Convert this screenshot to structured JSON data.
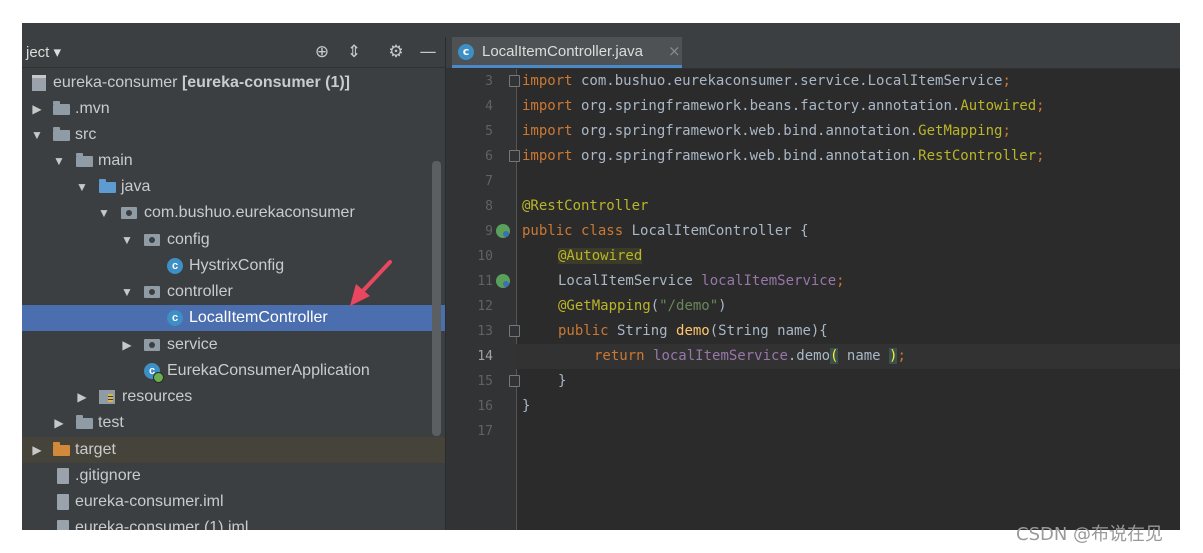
{
  "project_panel": {
    "title": "ject ▾",
    "tree": [
      {
        "label": "eureka-consumer",
        "bold": "[eureka-consumer (1)]"
      },
      {
        "label": ".mvn"
      },
      {
        "label": "src"
      },
      {
        "label": "main"
      },
      {
        "label": "java"
      },
      {
        "label": "com.bushuo.eurekaconsumer"
      },
      {
        "label": "config"
      },
      {
        "label": "HystrixConfig"
      },
      {
        "label": "controller"
      },
      {
        "label": "LocalItemController"
      },
      {
        "label": "service"
      },
      {
        "label": "EurekaConsumerApplication"
      },
      {
        "label": "resources"
      },
      {
        "label": "test"
      },
      {
        "label": "target"
      },
      {
        "label": ".gitignore"
      },
      {
        "label": "eureka-consumer.iml"
      },
      {
        "label": "eureka-consumer (1).iml"
      }
    ]
  },
  "editor": {
    "tab_label": "LocalItemController.java",
    "tab_close": "×",
    "line_numbers": [
      "3",
      "4",
      "5",
      "6",
      "7",
      "8",
      "9",
      "10",
      "11",
      "12",
      "13",
      "14",
      "15",
      "16",
      "17"
    ],
    "code": {
      "l3a": "import",
      "l3b": " com.bushuo.eurekaconsumer.service.LocalItemService",
      "l3c": ";",
      "l4a": "import",
      "l4b": " org.springframework.beans.factory.annotation.",
      "l4c": "Autowired",
      "l4d": ";",
      "l5a": "import",
      "l5b": " org.springframework.web.bind.annotation.",
      "l5c": "GetMapping",
      "l5d": ";",
      "l6a": "import",
      "l6b": " org.springframework.web.bind.annotation.",
      "l6c": "RestController",
      "l6d": ";",
      "l8a": "@RestController",
      "l9a": "public class",
      "l9b": " LocalItemController {",
      "l10a": "@Autowired",
      "l11a": "LocalItemService ",
      "l11b": "localItemService",
      "l11c": ";",
      "l12a": "@GetMapping",
      "l12b": "(",
      "l12c": "\"/demo\"",
      "l12d": ")",
      "l13a": "public",
      "l13b": " String ",
      "l13c": "demo",
      "l13d": "(String name){",
      "l14a": "return",
      "l14b": " ",
      "l14c": "localItemService",
      "l14d": ".demo",
      "l14e": "(",
      "l14f": " name ",
      "l14g": ")",
      "l14h": ";",
      "l15a": "}",
      "l16a": "}"
    }
  },
  "watermark": "CSDN @布说在见",
  "colors": {
    "selection": "#4b6eaf",
    "keyword": "#cc7832",
    "annotation": "#bbb529",
    "field": "#9876aa",
    "string": "#6a8759",
    "method": "#ffc66d",
    "arrow": "#e8475f"
  }
}
